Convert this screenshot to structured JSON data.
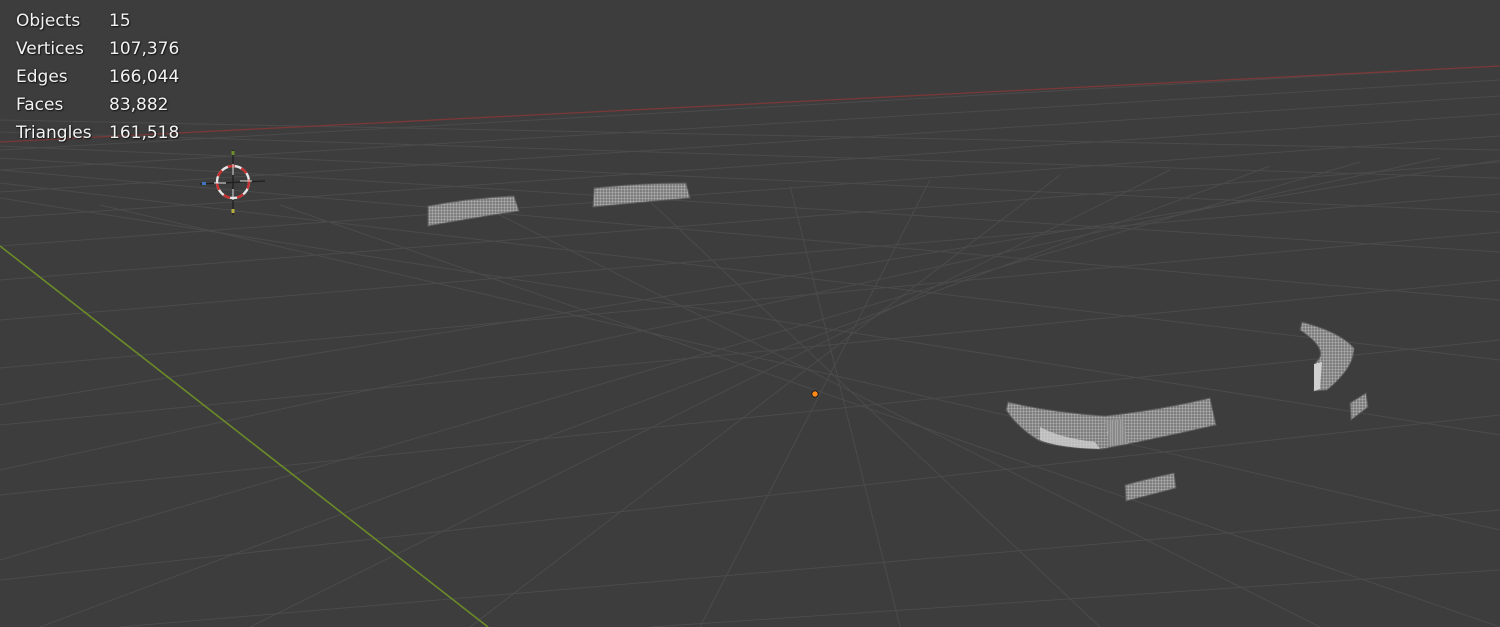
{
  "stats": [
    {
      "label": "Objects",
      "value": "15"
    },
    {
      "label": "Vertices",
      "value": "107,376"
    },
    {
      "label": "Edges",
      "value": "166,044"
    },
    {
      "label": "Faces",
      "value": "83,882"
    },
    {
      "label": "Triangles",
      "value": "161,518"
    }
  ],
  "colors": {
    "background": "#3d3d3d",
    "grid_line": "#4a4a4a",
    "x_axis": "#8a3a3a",
    "y_axis": "#6a8a2a",
    "mesh_fill": "#8c8c8c",
    "mesh_wire": "#b8b8b8",
    "cursor_red": "#c83030",
    "cursor_white": "#e0e0e0",
    "origin": "#ff8a1a"
  },
  "icons": {
    "cursor": "3d-cursor-icon",
    "origin": "object-origin-icon"
  }
}
